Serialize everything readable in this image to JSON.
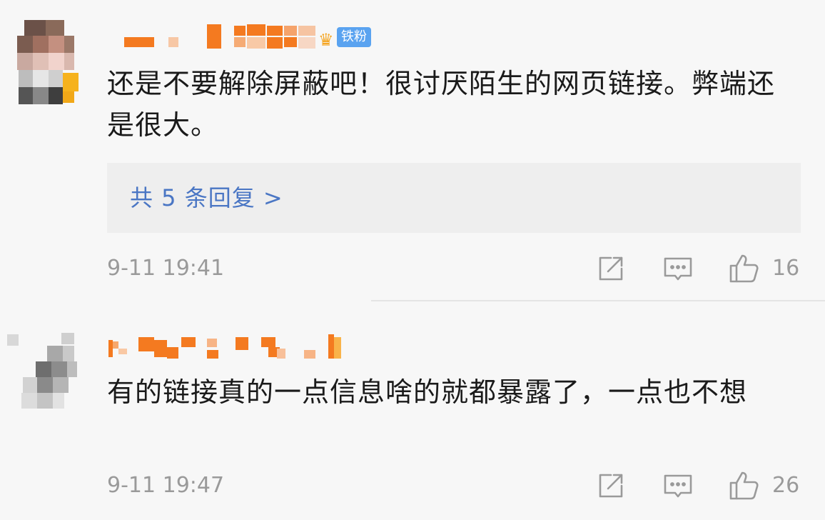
{
  "comments": [
    {
      "username": "",
      "badge_icon": "crown-icon",
      "badge": "铁粉",
      "text": "还是不要解除屏蔽吧！很讨厌陌生的网页链接。弊端还是很大。",
      "reply_link": "共 5 条回复 >",
      "time": "9-11 19:41",
      "likes": "16"
    },
    {
      "username": "",
      "text": "有的链接真的一点信息啥的就都暴露了，一点也不想",
      "time": "9-11 19:47",
      "likes": "26"
    }
  ],
  "icons": {
    "share": "share-icon",
    "comment": "comment-icon",
    "like": "thumbs-up-icon"
  },
  "colors": {
    "background": "#f7f7f7",
    "reply_box": "#eeeeee",
    "link": "#4a76c4",
    "meta_text": "#9a9a9a",
    "badge_bg": "#5aa3f0",
    "mosaic_orange": "#f47a20"
  }
}
